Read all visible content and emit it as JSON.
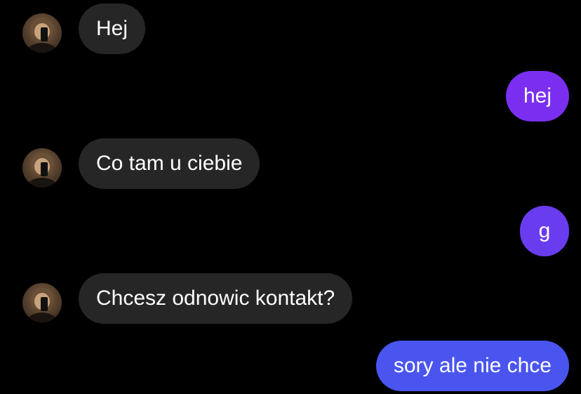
{
  "colors": {
    "background": "#000000",
    "incoming_bubble": "#262626",
    "outgoing_gradient": [
      "#7a2ff0",
      "#6a3cf0",
      "#5a4cf0",
      "#4a55ef"
    ],
    "text": "#ffffff"
  },
  "messages": [
    {
      "direction": "incoming",
      "text": "Hej",
      "avatar": "contact-avatar"
    },
    {
      "direction": "outgoing",
      "text": "hej"
    },
    {
      "direction": "incoming",
      "text": "Co tam u ciebie",
      "avatar": "contact-avatar"
    },
    {
      "direction": "outgoing",
      "text": "g"
    },
    {
      "direction": "incoming",
      "text": "Chcesz odnowic kontakt?",
      "avatar": "contact-avatar"
    },
    {
      "direction": "outgoing",
      "text": "sory ale nie chce"
    }
  ]
}
